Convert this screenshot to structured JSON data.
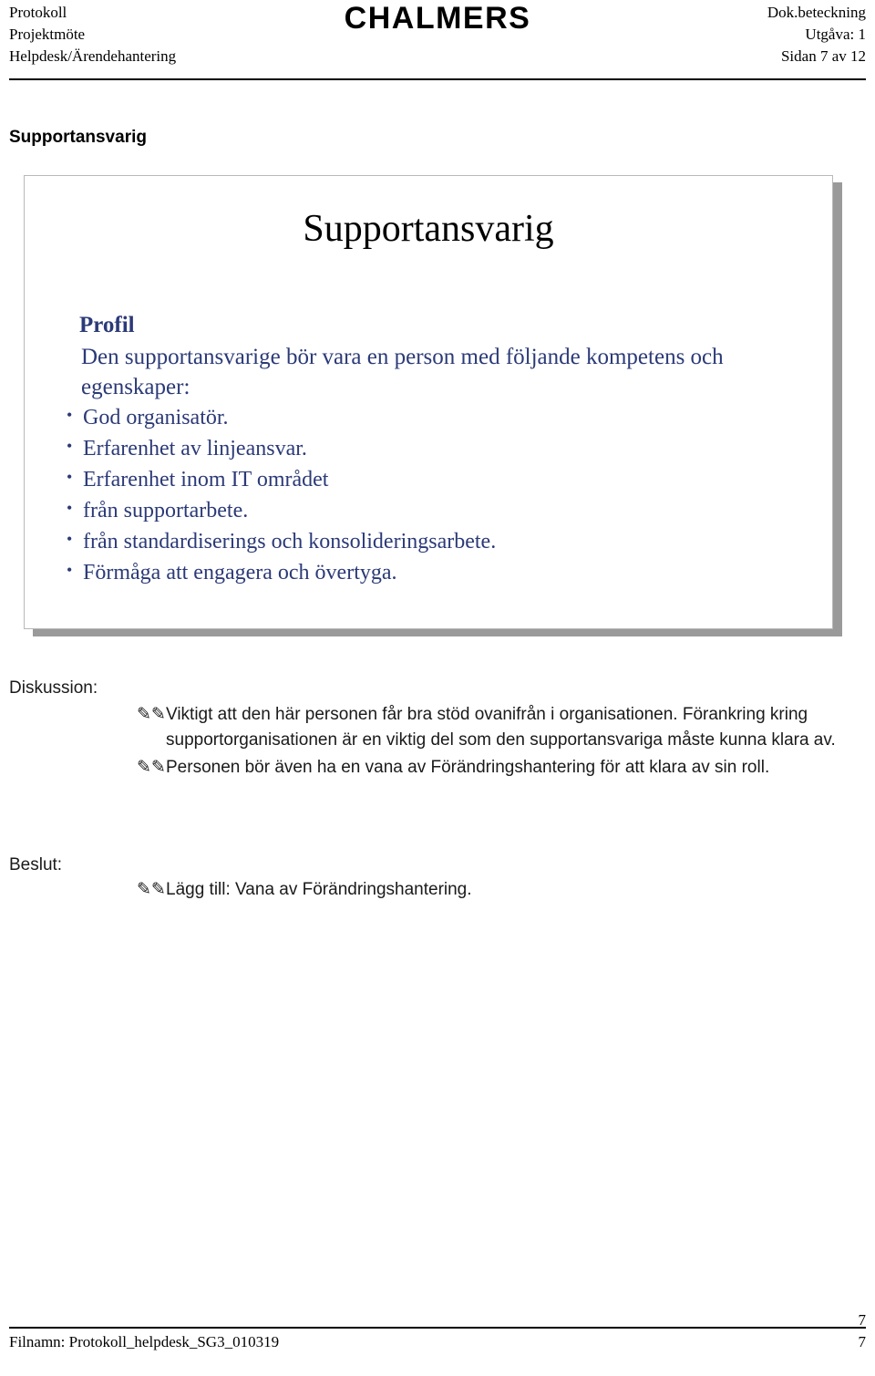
{
  "header": {
    "left_lines": [
      "Protokoll",
      "Projektmöte",
      "Helpdesk/Ärendehantering"
    ],
    "logo": "CHALMERS",
    "right_lines": [
      "Dok.beteckning",
      "Utgåva: 1",
      "Sidan 7 av 12"
    ]
  },
  "section_title": "Supportansvarig",
  "slide": {
    "title": "Supportansvarig",
    "profil_heading": "Profil",
    "lead": "Den supportansvarige bör vara en person med följande kompetens och egenskaper:",
    "bullets": [
      {
        "text": "God organisatör.",
        "level": 1
      },
      {
        "text": "Erfarenhet av linjeansvar.",
        "level": 1
      },
      {
        "text": "Erfarenhet inom IT området",
        "level": 1
      },
      {
        "text": "från supportarbete.",
        "level": 2
      },
      {
        "text": "från standardiserings och konsolideringsarbete.",
        "level": 3
      },
      {
        "text": "Förmåga att engagera och övertyga.",
        "level": 1
      }
    ],
    "accent_color": "#2b3a77"
  },
  "notes": {
    "discussion_label": "Diskussion:",
    "discussion_items": [
      "Viktigt att den här personen får bra stöd ovanifrån i organisationen. Förankring kring supportorganisationen är en viktig del som den supportansvariga måste kunna klara av.",
      "Personen bör även ha en vana av Förändringshantering för att klara av sin roll."
    ],
    "decision_label": "Beslut:",
    "decision_items": [
      "Lägg till: Vana av Förändringshantering."
    ],
    "bullet_glyph": "✎✎"
  },
  "footer": {
    "filename": "Filnamn: Protokoll_helpdesk_SG3_010319",
    "page_number_top": "7",
    "page_number_bottom": "7"
  }
}
